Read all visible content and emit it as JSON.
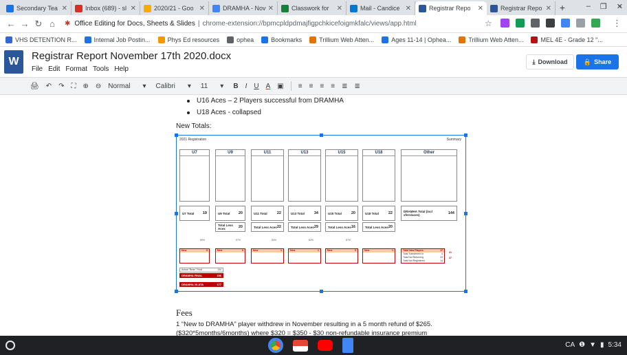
{
  "browser": {
    "tabs": [
      {
        "title": "Secondary Tea",
        "color": "#1a73e8"
      },
      {
        "title": "Inbox (689) - sl",
        "color": "#d93025"
      },
      {
        "title": "2020/21 - Goo",
        "color": "#f9ab00"
      },
      {
        "title": "DRAMHA - Nov",
        "color": "#4285f4"
      },
      {
        "title": "Classwork for",
        "color": "#188038"
      },
      {
        "title": "Mail - Candice",
        "color": "#0078d4"
      },
      {
        "title": "Registrar Repo",
        "color": "#2b579a",
        "active": true
      },
      {
        "title": "Registrar Repo",
        "color": "#2b579a"
      }
    ],
    "new_tab": "+",
    "url_host": "Office Editing for Docs, Sheets & Slides",
    "url_sep": "|",
    "url_path": "chrome-extension://bpmcpldpdmajfigpchkicefoigmkfalc/views/app.html",
    "bookmarks": [
      {
        "label": "VHS DETENTION R...",
        "color": "#3367d6"
      },
      {
        "label": "Internal Job Postin...",
        "color": "#1a73e8"
      },
      {
        "label": "Phys Ed resources",
        "color": "#f29900"
      },
      {
        "label": "ophea",
        "color": "#5f6368"
      },
      {
        "label": "Bookmarks",
        "color": "#1a73e8"
      },
      {
        "label": "Trillium Web Atten...",
        "color": "#e37400"
      },
      {
        "label": "Ages 11-14 | Ophea...",
        "color": "#1a73e8"
      },
      {
        "label": "Trillium Web Atten...",
        "color": "#e37400"
      },
      {
        "label": "MEL 4E - Grade 12 \"...",
        "color": "#b31412"
      }
    ]
  },
  "app": {
    "logo": "W",
    "doc_title": "Registrar Report November 17th 2020.docx",
    "menus": [
      "File",
      "Edit",
      "Format",
      "Tools",
      "Help"
    ],
    "download_label": "Download",
    "share_label": "Share"
  },
  "format_bar": {
    "style": "Normal",
    "font": "Calibri",
    "size": "11",
    "bold": "B",
    "italic": "I",
    "underline": "U",
    "text_color": "A"
  },
  "document": {
    "bullets": [
      "U16 Aces – 2 Players successful from DRAMHA",
      "U18 Aces - collapsed"
    ],
    "new_totals": "New Totals:",
    "fees_heading": "Fees",
    "fees_text_1": "1 “New to DRAMHA” player withdrew in November resulting in a 5 month refund of $265.",
    "fees_text_2": "($320*5months/6months) where $320 = $350 - $30 non-refundable insurance premium"
  },
  "sheet": {
    "title": "2021 Registration",
    "summary": "Summary",
    "divisions": [
      "U7",
      "U9",
      "U11",
      "U13",
      "U15",
      "U18",
      "Other"
    ],
    "totals": [
      {
        "label": "U7 Total",
        "value": "19"
      },
      {
        "label": "U9 Total",
        "value": "20"
      },
      {
        "label": "U11 Total",
        "value": "22"
      },
      {
        "label": "U13 Total",
        "value": "34"
      },
      {
        "label": "U15 Total",
        "value": "20"
      },
      {
        "label": "U18 Total",
        "value": "22"
      },
      {
        "label": "DRAMHA Total (incl xfers/aces)",
        "value": "144"
      }
    ],
    "less_aces": [
      {
        "label": "Total Less Aces",
        "value": "20"
      },
      {
        "label": "Total Less Aces",
        "value": "22"
      },
      {
        "label": "Total Less Aces",
        "value": "29"
      },
      {
        "label": "Total Less Aces",
        "value": "16"
      },
      {
        "label": "Total Less Aces",
        "value": "20"
      }
    ],
    "percents": [
      "89%",
      "97%",
      "84%",
      "82%",
      "87%"
    ],
    "new_boxes": [
      {
        "label": "New",
        "value": "5"
      },
      {
        "label": "New",
        "value": "6"
      },
      {
        "label": "New",
        "value": "1"
      },
      {
        "label": "New",
        "value": "1"
      },
      {
        "label": "New",
        "value": "5"
      },
      {
        "label": "New",
        "value": "1"
      }
    ],
    "summary_rows": [
      {
        "label": "Total New Players",
        "value": "17"
      },
      {
        "label": "Total Transferred In",
        "value": "4"
      },
      {
        "label": "Total Not Returning",
        "value": "23"
      },
      {
        "label": "Total Not Registered",
        "value": "14"
      }
    ],
    "summary_side": [
      "21",
      "37"
    ],
    "final_head": "Actual \"Bean\" Final",
    "final_value": "144",
    "final_bars": [
      {
        "label": "DRAMHA FINAL",
        "value": "156"
      },
      {
        "label": "DRAMHA 20-ATA",
        "value": "177"
      }
    ]
  },
  "shelf": {
    "tray_region": "CA",
    "tray_time": "5:34"
  }
}
